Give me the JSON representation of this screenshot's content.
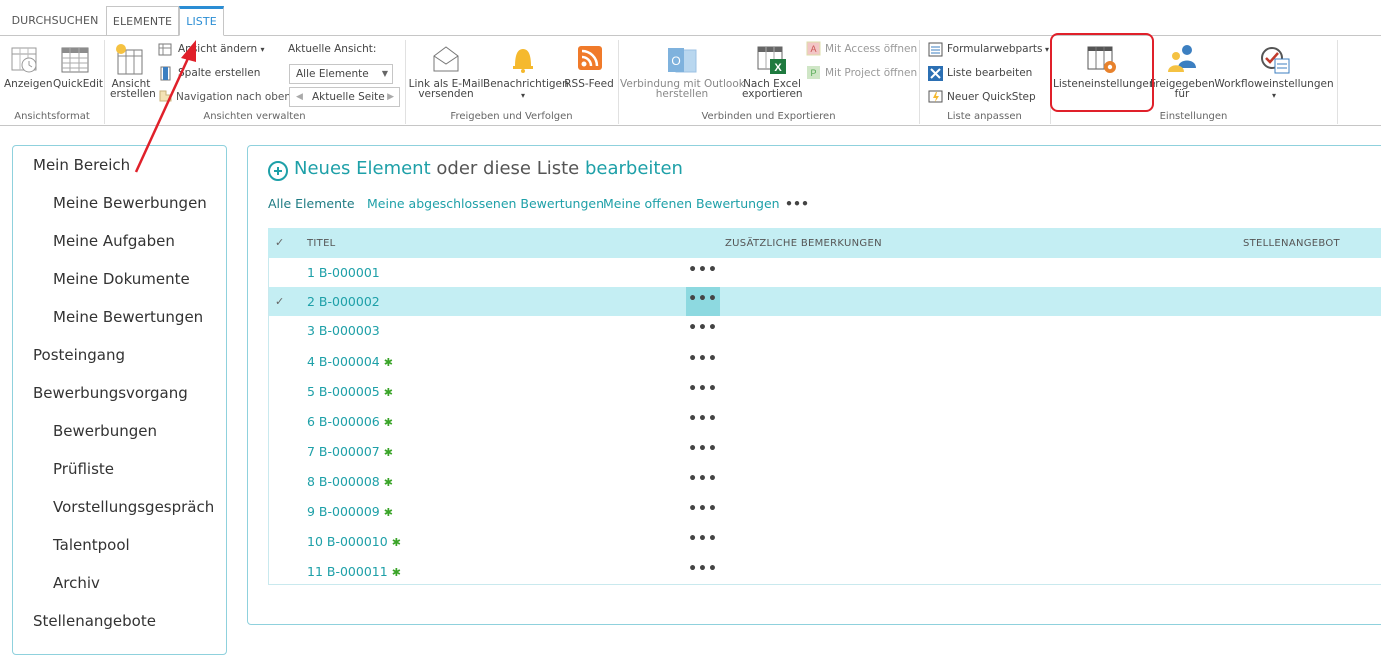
{
  "tabs": [
    {
      "label": "DURCHSUCHEN"
    },
    {
      "label": "ELEMENTE"
    },
    {
      "label": "LISTE"
    }
  ],
  "ribbon": {
    "ansichtsformat": {
      "group_label": "Ansichtsformat",
      "anzeigen": "Anzeigen",
      "quickedit": "QuickEdit"
    },
    "ansichten": {
      "group_label": "Ansichten verwalten",
      "ansicht_erstellen_1": "Ansicht",
      "ansicht_erstellen_2": "erstellen",
      "ansicht_aendern": "Ansicht ändern",
      "spalte_erstellen": "Spalte erstellen",
      "navigation": "Navigation nach oben",
      "aktuelle_ansicht_label": "Aktuelle Ansicht:",
      "aktuelle_ansicht_value": "Alle Elemente",
      "aktuelle_seite": "Aktuelle Seite"
    },
    "freigeben": {
      "group_label": "Freigeben und Verfolgen",
      "link_email_1": "Link als E-Mail",
      "link_email_2": "versenden",
      "benachrichtigen": "Benachrichtigen",
      "rss": "RSS-Feed"
    },
    "verbinden": {
      "group_label": "Verbinden und Exportieren",
      "outlook_1": "Verbindung mit Outlook",
      "outlook_2": "herstellen",
      "excel_1": "Nach Excel",
      "excel_2": "exportieren",
      "access": "Mit Access öffnen",
      "project": "Mit Project öffnen"
    },
    "anpassen": {
      "group_label": "Liste anpassen",
      "formularwebparts": "Formularwebparts",
      "liste_bearbeiten": "Liste bearbeiten",
      "quickstep": "Neuer QuickStep"
    },
    "einstellungen": {
      "group_label": "Einstellungen",
      "listeneinstellungen": "Listeneinstellungen",
      "freigegeben_1": "Freigegeben",
      "freigegeben_2": "für",
      "workflow": "Workfloweinstellungen"
    }
  },
  "leftnav": {
    "items": [
      {
        "label": "Mein Bereich"
      },
      {
        "label": "Meine Bewerbungen"
      },
      {
        "label": "Meine Aufgaben"
      },
      {
        "label": "Meine Dokumente"
      },
      {
        "label": "Meine Bewertungen"
      },
      {
        "label": "Posteingang"
      },
      {
        "label": "Bewerbungsvorgang"
      },
      {
        "label": "Bewerbungen"
      },
      {
        "label": "Prüfliste"
      },
      {
        "label": "Vorstellungsgespräch"
      },
      {
        "label": "Talentpool"
      },
      {
        "label": "Archiv"
      },
      {
        "label": "Stellenangebote"
      }
    ]
  },
  "main": {
    "new_item": "Neues Element",
    "or_edit": "oder diese Liste",
    "edit": "bearbeiten",
    "views": [
      {
        "label": "Alle Elemente"
      },
      {
        "label": "Meine abgeschlossenen Bewertungen"
      },
      {
        "label": "Meine offenen Bewertungen"
      },
      {
        "label": "•••"
      }
    ],
    "columns": {
      "titel": "TITEL",
      "bemerkungen": "ZUSÄTZLICHE BEMERKUNGEN",
      "stellenangebot": "STELLENANGEBOT"
    },
    "rows": [
      {
        "title": "1 B-000001",
        "new": ""
      },
      {
        "title": "2 B-000002",
        "new": ""
      },
      {
        "title": "3 B-000003",
        "new": ""
      },
      {
        "title": "4 B-000004",
        "new": "✱"
      },
      {
        "title": "5 B-000005",
        "new": "✱"
      },
      {
        "title": "6 B-000006",
        "new": "✱"
      },
      {
        "title": "7 B-000007",
        "new": "✱"
      },
      {
        "title": "8 B-000008",
        "new": "✱"
      },
      {
        "title": "9 B-000009",
        "new": "✱"
      },
      {
        "title": "10 B-000010",
        "new": "✱"
      },
      {
        "title": "11 B-000011",
        "new": "✱"
      }
    ],
    "row_menu": "•••",
    "check_glyph": "✓",
    "selected_row": 2
  },
  "colors": {
    "accent": "#1ea0a8",
    "tab_active": "#2a8dd4",
    "header_bg": "#c4eef3",
    "annotation": "#e0202a"
  }
}
